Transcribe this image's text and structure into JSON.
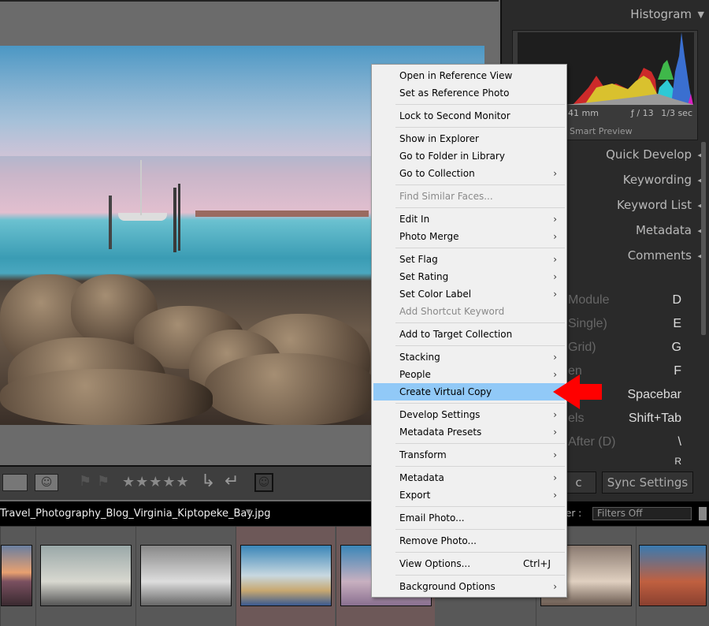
{
  "right_panel": {
    "histogram": {
      "title": "Histogram",
      "focal_length": "41 mm",
      "aperture": "ƒ / 13",
      "shutter": "1/3 sec",
      "preview": "Smart Preview"
    },
    "sections": [
      "Quick Develop",
      "Keywording",
      "Keyword List",
      "Metadata",
      "Comments"
    ],
    "shortcuts": [
      {
        "label": "Module",
        "key": "D"
      },
      {
        "label": "Single)",
        "key": "E"
      },
      {
        "label": "Grid)",
        "key": "G"
      },
      {
        "label": "en",
        "key": "F"
      },
      {
        "label": "",
        "key": "Spacebar"
      },
      {
        "label": "els",
        "key": "Shift+Tab"
      },
      {
        "label": "After (D)",
        "key": "\\"
      },
      {
        "label": "",
        "key": "R"
      }
    ],
    "sync_left": "c",
    "sync_settings": "Sync Settings",
    "filter_label": "er :",
    "filter_value": "Filters Off"
  },
  "filename": "Travel_Photography_Blog_Virginia_Kiptopeke_Bay.jpg",
  "context_menu": {
    "items": [
      {
        "label": "Open in Reference View"
      },
      {
        "label": "Set as Reference Photo"
      },
      {
        "sep": true
      },
      {
        "label": "Lock to Second Monitor"
      },
      {
        "sep": true
      },
      {
        "label": "Show in Explorer"
      },
      {
        "label": "Go to Folder in Library"
      },
      {
        "label": "Go to Collection",
        "sub": true
      },
      {
        "sep": true
      },
      {
        "label": "Find Similar Faces...",
        "disabled": true
      },
      {
        "sep": true
      },
      {
        "label": "Edit In",
        "sub": true
      },
      {
        "label": "Photo Merge",
        "sub": true
      },
      {
        "sep": true
      },
      {
        "label": "Set Flag",
        "sub": true
      },
      {
        "label": "Set Rating",
        "sub": true
      },
      {
        "label": "Set Color Label",
        "sub": true
      },
      {
        "label": "Add Shortcut Keyword",
        "disabled": true
      },
      {
        "sep": true
      },
      {
        "label": "Add to Target Collection"
      },
      {
        "sep": true
      },
      {
        "label": "Stacking",
        "sub": true
      },
      {
        "label": "People",
        "sub": true
      },
      {
        "label": "Create Virtual Copy",
        "highlighted": true
      },
      {
        "sep": true
      },
      {
        "label": "Develop Settings",
        "sub": true
      },
      {
        "label": "Metadata Presets",
        "sub": true
      },
      {
        "sep": true
      },
      {
        "label": "Transform",
        "sub": true
      },
      {
        "sep": true
      },
      {
        "label": "Metadata",
        "sub": true
      },
      {
        "label": "Export",
        "sub": true
      },
      {
        "sep": true
      },
      {
        "label": "Email Photo..."
      },
      {
        "sep": true
      },
      {
        "label": "Remove Photo..."
      },
      {
        "sep": true
      },
      {
        "label": "View Options...",
        "shortcut": "Ctrl+J"
      },
      {
        "sep": true
      },
      {
        "label": "Background Options",
        "sub": true
      }
    ]
  },
  "toolbar": {
    "rating": "★★★★★"
  },
  "colors": {
    "highlight": "#91c9f7",
    "arrow": "#ff0000",
    "panel": "#2a2a2a"
  }
}
